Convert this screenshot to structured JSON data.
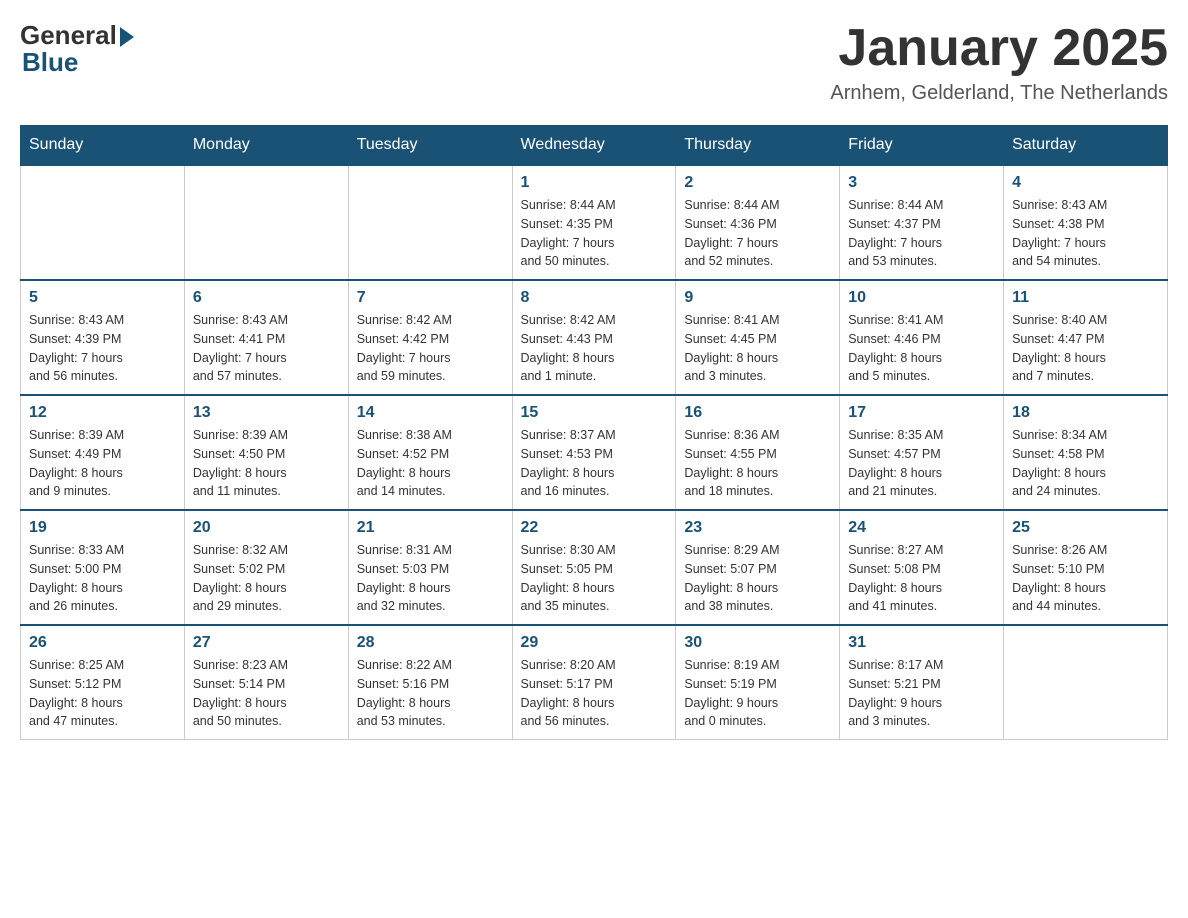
{
  "logo": {
    "general": "General",
    "blue": "Blue"
  },
  "title": "January 2025",
  "location": "Arnhem, Gelderland, The Netherlands",
  "days_of_week": [
    "Sunday",
    "Monday",
    "Tuesday",
    "Wednesday",
    "Thursday",
    "Friday",
    "Saturday"
  ],
  "weeks": [
    [
      {
        "day": "",
        "info": ""
      },
      {
        "day": "",
        "info": ""
      },
      {
        "day": "",
        "info": ""
      },
      {
        "day": "1",
        "info": "Sunrise: 8:44 AM\nSunset: 4:35 PM\nDaylight: 7 hours\nand 50 minutes."
      },
      {
        "day": "2",
        "info": "Sunrise: 8:44 AM\nSunset: 4:36 PM\nDaylight: 7 hours\nand 52 minutes."
      },
      {
        "day": "3",
        "info": "Sunrise: 8:44 AM\nSunset: 4:37 PM\nDaylight: 7 hours\nand 53 minutes."
      },
      {
        "day": "4",
        "info": "Sunrise: 8:43 AM\nSunset: 4:38 PM\nDaylight: 7 hours\nand 54 minutes."
      }
    ],
    [
      {
        "day": "5",
        "info": "Sunrise: 8:43 AM\nSunset: 4:39 PM\nDaylight: 7 hours\nand 56 minutes."
      },
      {
        "day": "6",
        "info": "Sunrise: 8:43 AM\nSunset: 4:41 PM\nDaylight: 7 hours\nand 57 minutes."
      },
      {
        "day": "7",
        "info": "Sunrise: 8:42 AM\nSunset: 4:42 PM\nDaylight: 7 hours\nand 59 minutes."
      },
      {
        "day": "8",
        "info": "Sunrise: 8:42 AM\nSunset: 4:43 PM\nDaylight: 8 hours\nand 1 minute."
      },
      {
        "day": "9",
        "info": "Sunrise: 8:41 AM\nSunset: 4:45 PM\nDaylight: 8 hours\nand 3 minutes."
      },
      {
        "day": "10",
        "info": "Sunrise: 8:41 AM\nSunset: 4:46 PM\nDaylight: 8 hours\nand 5 minutes."
      },
      {
        "day": "11",
        "info": "Sunrise: 8:40 AM\nSunset: 4:47 PM\nDaylight: 8 hours\nand 7 minutes."
      }
    ],
    [
      {
        "day": "12",
        "info": "Sunrise: 8:39 AM\nSunset: 4:49 PM\nDaylight: 8 hours\nand 9 minutes."
      },
      {
        "day": "13",
        "info": "Sunrise: 8:39 AM\nSunset: 4:50 PM\nDaylight: 8 hours\nand 11 minutes."
      },
      {
        "day": "14",
        "info": "Sunrise: 8:38 AM\nSunset: 4:52 PM\nDaylight: 8 hours\nand 14 minutes."
      },
      {
        "day": "15",
        "info": "Sunrise: 8:37 AM\nSunset: 4:53 PM\nDaylight: 8 hours\nand 16 minutes."
      },
      {
        "day": "16",
        "info": "Sunrise: 8:36 AM\nSunset: 4:55 PM\nDaylight: 8 hours\nand 18 minutes."
      },
      {
        "day": "17",
        "info": "Sunrise: 8:35 AM\nSunset: 4:57 PM\nDaylight: 8 hours\nand 21 minutes."
      },
      {
        "day": "18",
        "info": "Sunrise: 8:34 AM\nSunset: 4:58 PM\nDaylight: 8 hours\nand 24 minutes."
      }
    ],
    [
      {
        "day": "19",
        "info": "Sunrise: 8:33 AM\nSunset: 5:00 PM\nDaylight: 8 hours\nand 26 minutes."
      },
      {
        "day": "20",
        "info": "Sunrise: 8:32 AM\nSunset: 5:02 PM\nDaylight: 8 hours\nand 29 minutes."
      },
      {
        "day": "21",
        "info": "Sunrise: 8:31 AM\nSunset: 5:03 PM\nDaylight: 8 hours\nand 32 minutes."
      },
      {
        "day": "22",
        "info": "Sunrise: 8:30 AM\nSunset: 5:05 PM\nDaylight: 8 hours\nand 35 minutes."
      },
      {
        "day": "23",
        "info": "Sunrise: 8:29 AM\nSunset: 5:07 PM\nDaylight: 8 hours\nand 38 minutes."
      },
      {
        "day": "24",
        "info": "Sunrise: 8:27 AM\nSunset: 5:08 PM\nDaylight: 8 hours\nand 41 minutes."
      },
      {
        "day": "25",
        "info": "Sunrise: 8:26 AM\nSunset: 5:10 PM\nDaylight: 8 hours\nand 44 minutes."
      }
    ],
    [
      {
        "day": "26",
        "info": "Sunrise: 8:25 AM\nSunset: 5:12 PM\nDaylight: 8 hours\nand 47 minutes."
      },
      {
        "day": "27",
        "info": "Sunrise: 8:23 AM\nSunset: 5:14 PM\nDaylight: 8 hours\nand 50 minutes."
      },
      {
        "day": "28",
        "info": "Sunrise: 8:22 AM\nSunset: 5:16 PM\nDaylight: 8 hours\nand 53 minutes."
      },
      {
        "day": "29",
        "info": "Sunrise: 8:20 AM\nSunset: 5:17 PM\nDaylight: 8 hours\nand 56 minutes."
      },
      {
        "day": "30",
        "info": "Sunrise: 8:19 AM\nSunset: 5:19 PM\nDaylight: 9 hours\nand 0 minutes."
      },
      {
        "day": "31",
        "info": "Sunrise: 8:17 AM\nSunset: 5:21 PM\nDaylight: 9 hours\nand 3 minutes."
      },
      {
        "day": "",
        "info": ""
      }
    ]
  ]
}
